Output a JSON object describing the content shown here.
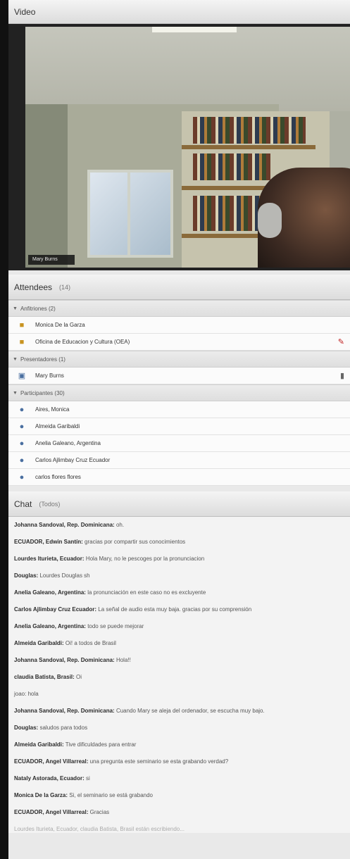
{
  "video": {
    "title": "Video",
    "speaker_name": "Mary Burns"
  },
  "attendees": {
    "title": "Attendees",
    "count": "(14)",
    "groups": [
      {
        "label": "Anfitriones (2)",
        "members": [
          "Monica De la Garza",
          "Oficina de Educacion y Cultura (OEA)"
        ]
      },
      {
        "label": "Presentadores (1)",
        "members": [
          "Mary Burns"
        ]
      },
      {
        "label": "Participantes (30)",
        "members": [
          "Aires, Monica",
          "Almeida Garibaldi",
          "Anelia Galeano, Argentina",
          "Carlos Ajlimbay Cruz Ecuador",
          "carlos flores flores"
        ]
      }
    ]
  },
  "chat": {
    "title": "Chat",
    "scope": "(Todos)",
    "messages": [
      {
        "sender": "Johanna Sandoval, Rep. Dominicana:",
        "text": "oh."
      },
      {
        "sender": "ECUADOR, Edwin Santín:",
        "text": "gracias por compartir sus conocimientos"
      },
      {
        "sender": "Lourdes Iturieta, Ecuador:",
        "text": "Hola Mary, no le pescoges por la pronunciacion"
      },
      {
        "sender": "Douglas:",
        "text": "Lourdes Douglas sh"
      },
      {
        "sender": "Anelia Galeano, Argentina:",
        "text": "la pronunciación en este caso no es excluyente"
      },
      {
        "sender": "Carlos Ajlimbay Cruz Ecuador:",
        "text": "La señal de audio esta muy baja. gracias por su comprensión"
      },
      {
        "sender": "Anelia Galeano, Argentina:",
        "text": "todo se puede mejorar"
      },
      {
        "sender": "Almeida Garibaldi:",
        "text": "Oi! a todos de Brasil"
      },
      {
        "sender": "Johanna Sandoval, Rep. Dominicana:",
        "text": "Hola!!"
      },
      {
        "sender": "claudia Batista, Brasil:",
        "text": "Oi"
      },
      {
        "sender": "",
        "text": "joao: hola"
      },
      {
        "sender": "Johanna Sandoval, Rep. Dominicana:",
        "text": "Cuando Mary se aleja del ordenador, se escucha muy bajo."
      },
      {
        "sender": "Douglas:",
        "text": "saludos para todos"
      },
      {
        "sender": "Almeida Garibaldi:",
        "text": "Tive dificuldades para entrar"
      },
      {
        "sender": "ECUADOR, Angel Villarreal:",
        "text": "una pregunta este seminario se esta grabando verdad?"
      },
      {
        "sender": "Nataly Astorada, Ecuador:",
        "text": "si"
      },
      {
        "sender": "Monica De la Garza:",
        "text": "Si, el seminario se está grabando"
      },
      {
        "sender": "ECUADOR, Angel Villarreal:",
        "text": "Gracias"
      }
    ],
    "typing_status": "Lourdes Iturieta, Ecuador, claudia Batista, Brasil están escribiendo..."
  }
}
